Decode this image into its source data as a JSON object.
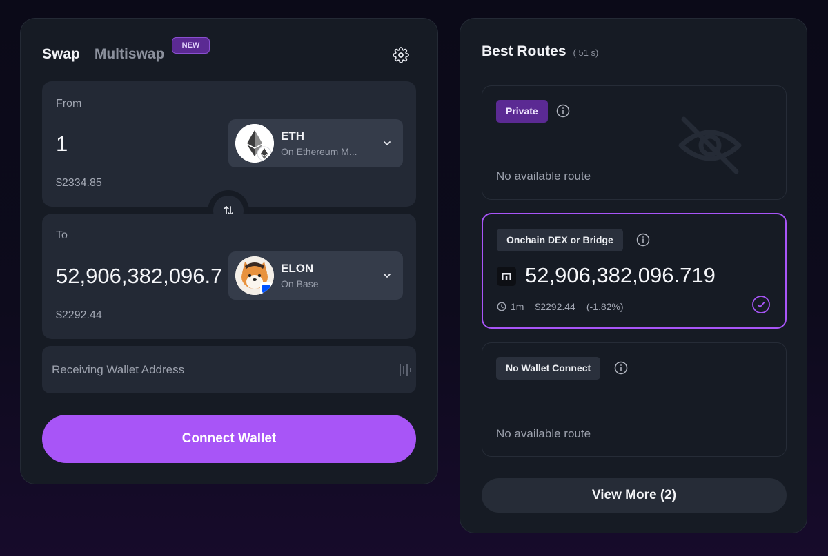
{
  "swap": {
    "tabs": {
      "swap": "Swap",
      "multiswap": "Multiswap",
      "new_badge": "NEW"
    },
    "settings_icon": "gear-icon",
    "from": {
      "label": "From",
      "amount": "1",
      "usd_value": "$2334.85",
      "token": {
        "symbol": "ETH",
        "network": "On Ethereum M...",
        "icon": "ethereum-logo"
      }
    },
    "to": {
      "label": "To",
      "amount": "52,906,382,096.7",
      "usd_value": "$2292.44",
      "token": {
        "symbol": "ELON",
        "network": "On Base",
        "icon": "elon-shiba-logo"
      }
    },
    "flip_icon": "swap-arrows-icon",
    "wallet_address": {
      "placeholder": "Receiving Wallet Address",
      "value": ""
    },
    "connect_label": "Connect Wallet"
  },
  "routes": {
    "title": "Best Routes",
    "refresh_time": "( 51 s)",
    "cards": [
      {
        "tag": "Private",
        "status": "No available route",
        "style": "purple",
        "icon": "eye-off-icon"
      },
      {
        "tag": "Onchain DEX or Bridge",
        "amount": "52,906,382,096.719",
        "time": "1m",
        "usd_value": "$2292.44",
        "change": "(-1.82%)",
        "selected": true
      },
      {
        "tag": "No Wallet Connect",
        "status": "No available route",
        "style": "gray"
      }
    ],
    "view_more_label": "View More (2)"
  },
  "colors": {
    "accent": "#a855f7",
    "tag_purple": "#5b2a93",
    "panel_bg": "#161b24",
    "field_bg": "#232935"
  }
}
